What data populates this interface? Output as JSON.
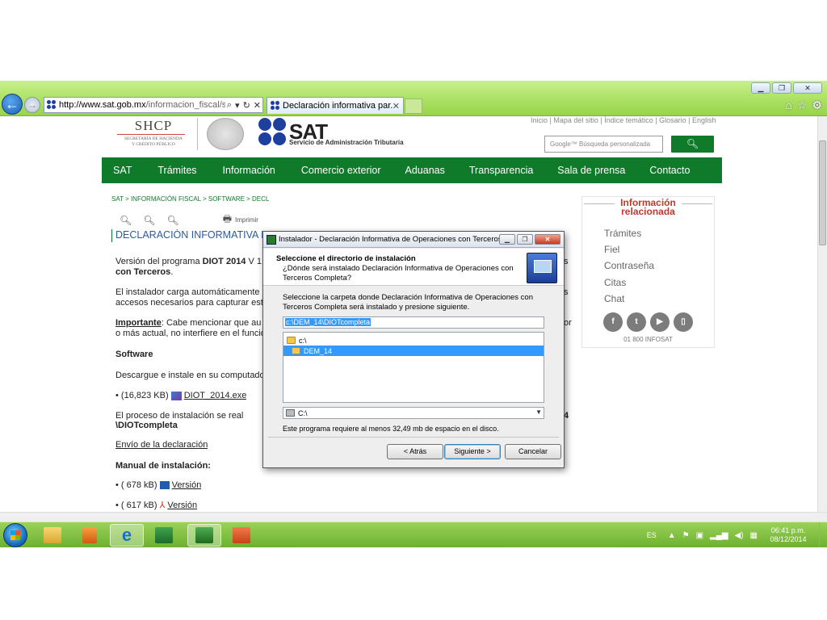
{
  "browser": {
    "address_host": "http://www.sat.gob.mx",
    "address_path": "/informacion_fiscal/softwar",
    "tab_title": "Declaración informativa par...",
    "window_controls": [
      "minimize-icon",
      "maximize-icon",
      "close-icon"
    ]
  },
  "site": {
    "shcp_title": "SHCP",
    "shcp_subtitle_1": "SECRETARÍA DE HACIENDA",
    "shcp_subtitle_2": "Y CRÉDITO PÚBLICO",
    "sat_wordmark": "SAT",
    "sat_subtitle": "Servicio de Administración Tributaria",
    "top_links": "Inicio | Mapa del sitio | Índice temático | Glosario | English",
    "search_placeholder": "Google™ Búsqueda personalizada",
    "nav": [
      "SAT",
      "Trámites",
      "Información",
      "Comercio exterior",
      "Aduanas",
      "Transparencia",
      "Sala de prensa",
      "Contacto"
    ],
    "breadcrumb": "SAT > INFORMACIÓN FISCAL > SOFTWARE > DECL",
    "imprimir": "Imprimir",
    "heading": "DECLARACIÓN INFORMATIVA PA",
    "para1_a": "Versión del programa ",
    "para1_b": "DIOT 2014",
    "para1_c": " V 1",
    "para1_line2": "con Terceros",
    "para1_tail": ".",
    "para2_l1": "El instalador carga automáticamente",
    "para2_l2": "accesos necesarios para capturar est",
    "para3_a": "Importante",
    "para3_b": ": Cabe mencionar que au",
    "para3_l2": "o más actual, no interfiere en el funcio",
    "software": "Software",
    "para4": "Descargue e instale en su computado",
    "download_size": "• (16,823 KB)",
    "download_link": "DIOT_2014.exe",
    "para5_l1": "El proceso de instalación se real",
    "para5_l2": "\\DIOTcompleta",
    "right_frag_1": "s",
    "right_frag_2": "s",
    "right_frag_3": "or",
    "right_frag_4": "4",
    "envio": "Envío de la declaración",
    "manual": "Manual de instalación:",
    "manual_1_size": "• ( 678 kB)",
    "manual_1_link": "Versión",
    "manual_2_size": "• ( 617 kB)",
    "manual_2_link": "Versión",
    "info_title_1": "Información",
    "info_title_2": "relacionada",
    "side_links": [
      "Trámites",
      "Fiel",
      "Contraseña",
      "Citas",
      "Chat"
    ],
    "infosat": "01 800 INFOSAT"
  },
  "dialog": {
    "title": "Instalador - Declaración Informativa de Operaciones con Terceros ...",
    "header_title": "Seleccione el directorio de instalación",
    "header_question": "¿Dónde será instalado Declaración Informativa de Operaciones con Terceros Completa?",
    "description": "Seleccione la carpeta donde Declaración Informativa de Operaciones con Terceros Completa será instalado y presione siguiente.",
    "path_value": "c:\\DEM_14\\DIOTcompleta",
    "tree_root": "c:\\",
    "tree_selected": "DEM_14",
    "drive_value": "C:\\",
    "space_required": "Este programa requiere al menos 32,49 mb de espacio en el disco.",
    "btn_back": "< Atrás",
    "btn_next": "Siguiente >",
    "btn_cancel": "Cancelar"
  },
  "taskbar": {
    "language": "ES",
    "time": "06:41 p.m.",
    "date": "08/12/2014"
  },
  "colors": {
    "sat_green": "#0f7a2a",
    "sat_blue": "#1e3f9e",
    "info_red": "#c0392b",
    "selection_blue": "#3399ff"
  }
}
